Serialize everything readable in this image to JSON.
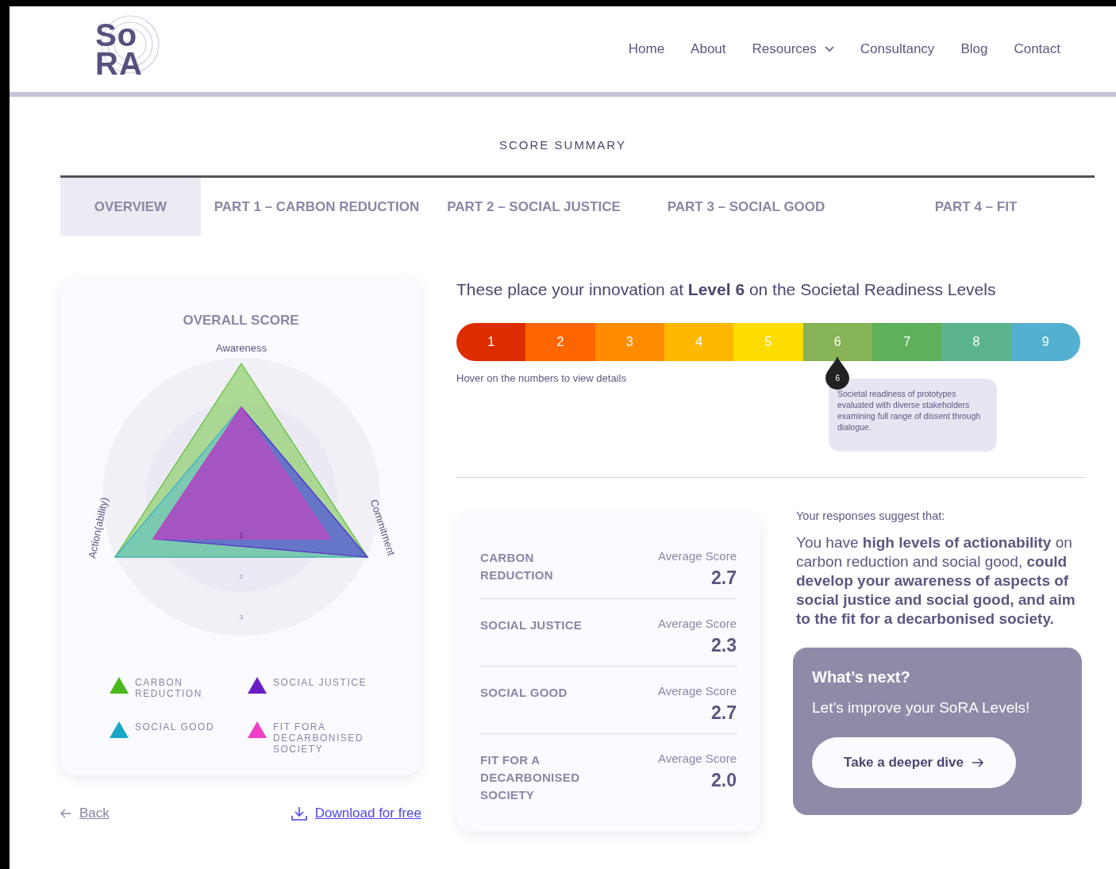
{
  "logo": {
    "line_1": "So",
    "line_2": "RA"
  },
  "nav": [
    {
      "label": "Home",
      "dropdown": false
    },
    {
      "label": "About",
      "dropdown": false
    },
    {
      "label": "Resources",
      "dropdown": true
    },
    {
      "label": "Consultancy",
      "dropdown": false
    },
    {
      "label": "Blog",
      "dropdown": false
    },
    {
      "label": "Contact",
      "dropdown": false
    }
  ],
  "page_title": "SCORE SUMMARY",
  "tabs": [
    {
      "label": "OVERVIEW",
      "selected": true
    },
    {
      "label": "PART 1 – CARBON REDUCTION",
      "selected": false
    },
    {
      "label": "PART 2 – SOCIAL JUSTICE",
      "selected": false
    },
    {
      "label": "PART 3 – SOCIAL GOOD",
      "selected": false
    },
    {
      "label": "PART 4 – FIT",
      "selected": false
    }
  ],
  "overall": {
    "title": "OVERALL SCORE",
    "axes": [
      "Awareness",
      "Commitment",
      "Action(ability)"
    ],
    "ring_labels": [
      "1",
      "2",
      "3"
    ],
    "legend": [
      {
        "label": "CARBON REDUCTION",
        "color": "#4cb81e"
      },
      {
        "label": "SOCIAL JUSTICE",
        "color": "#6a1fc4"
      },
      {
        "label": "SOCIAL GOOD",
        "color": "#19a6c4"
      },
      {
        "label": "FIT FORA DECARBONISED SOCIETY",
        "color": "#ee3fc6"
      }
    ]
  },
  "links": {
    "back": "Back",
    "download": "Download for free"
  },
  "level_heading": "These place your innovation at **Level 6** on the Societal Readiness Levels",
  "levels": [
    {
      "label": "1",
      "color": "#dd2c00",
      "selected": false
    },
    {
      "label": "2",
      "color": "#ff6600",
      "selected": false
    },
    {
      "label": "3",
      "color": "#ff8c00",
      "selected": false
    },
    {
      "label": "4",
      "color": "#ffb800",
      "selected": false
    },
    {
      "label": "5",
      "color": "#ffdc00",
      "selected": false
    },
    {
      "label": "6",
      "color": "#86b456",
      "selected": true
    },
    {
      "label": "7",
      "color": "#5fb05a",
      "selected": false
    },
    {
      "label": "8",
      "color": "#5cb48c",
      "selected": false
    },
    {
      "label": "9",
      "color": "#54b0d0",
      "selected": false
    }
  ],
  "level_hint": "Hover on the numbers to view details",
  "marker": {
    "label": "6",
    "text": "Societal readiness of prototypes evaluated with diverse stakeholders examining full range of dissent through dialogue."
  },
  "scores": [
    {
      "name": "CARBON REDUCTION",
      "caption": "Average Score",
      "value": "2.7"
    },
    {
      "name": "SOCIAL JUSTICE",
      "caption": "Average Score",
      "value": "2.3"
    },
    {
      "name": "SOCIAL GOOD",
      "caption": "Average Score",
      "value": "2.7"
    },
    {
      "name": "FIT FOR A DECARBONISED SOCIETY",
      "caption": "Average Score",
      "value": "2.0"
    }
  ],
  "suggest_intro": "Your responses suggest that:",
  "suggestion": "You have **high levels of actionability** on carbon reduction and social good, **could develop your awareness of aspects of social justice and social good, and aim to the fit for a decarbonised society.**",
  "next": {
    "title": "What’s next?",
    "text": "Let’s improve your SoRA Levels!",
    "button": "Take a deeper dive"
  }
}
